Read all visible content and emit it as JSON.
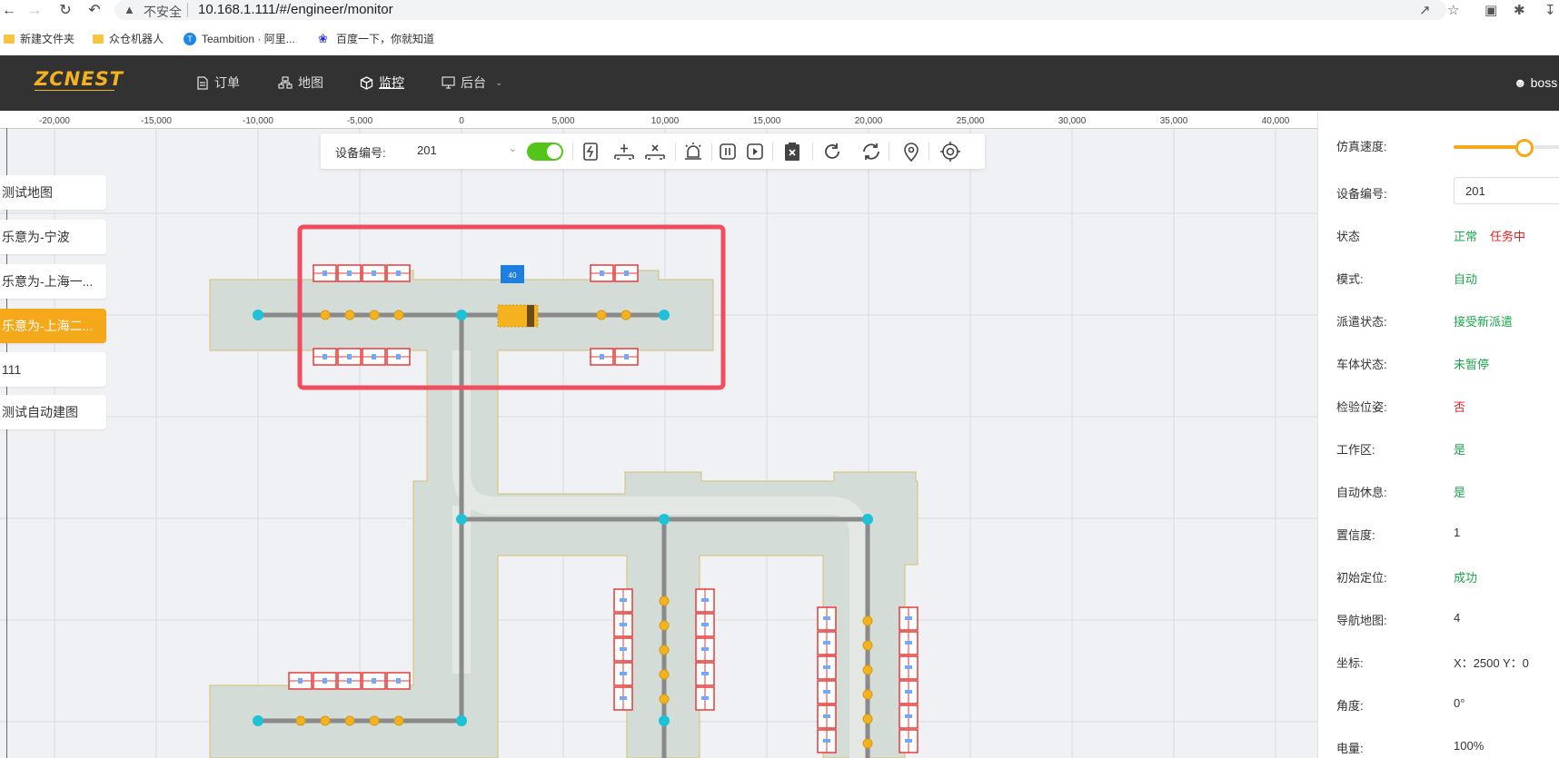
{
  "browser": {
    "url_warning": "不安全",
    "url": "10.168.1.111/#/engineer/monitor",
    "bookmarks": [
      "新建文件夹",
      "众仓机器人",
      "Teambition · 阿里...",
      "百度一下，你就知道"
    ]
  },
  "header": {
    "logo": "ZCNEST",
    "menu": [
      {
        "label": "订单",
        "icon": "document-icon"
      },
      {
        "label": "地图",
        "icon": "sitemap-icon"
      },
      {
        "label": "监控",
        "icon": "cube-icon",
        "active": true
      },
      {
        "label": "后台",
        "icon": "monitor-icon",
        "dropdown": true
      }
    ],
    "user": "boss"
  },
  "ruler": {
    "ticks": [
      "-20,000",
      "-15,000",
      "-10,000",
      "-5,000",
      "0",
      "5,000",
      "10,000",
      "15,000",
      "20,000",
      "25,000",
      "30,000",
      "35,000",
      "40,000"
    ]
  },
  "map_list": [
    {
      "label": "测试地图"
    },
    {
      "label": "乐意为-宁波"
    },
    {
      "label": "乐意为-上海一..."
    },
    {
      "label": "乐意为-上海二...",
      "active": true
    },
    {
      "label": "111"
    },
    {
      "label": "测试自动建图"
    }
  ],
  "toolbar": {
    "device_label": "设备编号:",
    "device_value": "201",
    "auto_switch_on": true,
    "icons": [
      "charge-icon",
      "pallet-add-icon",
      "pallet-remove-icon",
      "alarm-icon",
      "pause-icon",
      "play-icon",
      "clear-icon",
      "refresh-icon",
      "sync-icon",
      "location-pin-icon",
      "target-icon"
    ]
  },
  "map": {
    "vehicle_badge": "40",
    "colors": {
      "floor": "#d3dcd6",
      "highlight": "#f04d5f",
      "shelf": "#e83a3a",
      "node": "#1ec2d6",
      "station": "#f5b21f"
    }
  },
  "right_panel": {
    "speed_label": "仿真速度:",
    "speed_level": 0.6,
    "device_label": "设备编号:",
    "device_value": "201",
    "rows": [
      {
        "label": "状态",
        "value": "正常",
        "color": "green",
        "extra": "任务中",
        "extra_color": "red"
      },
      {
        "label": "模式:",
        "value": "自动",
        "color": "green"
      },
      {
        "label": "派遣状态:",
        "value": "接受新派遣",
        "color": "green"
      },
      {
        "label": "车体状态:",
        "value": "未暂停",
        "color": "green"
      },
      {
        "label": "检验位姿:",
        "value": "否",
        "color": "red"
      },
      {
        "label": "工作区:",
        "value": "是",
        "color": "green"
      },
      {
        "label": "自动休息:",
        "value": "是",
        "color": "green"
      },
      {
        "label": "置信度:",
        "value": "1",
        "color": "plain"
      },
      {
        "label": "初始定位:",
        "value": "成功",
        "color": "green"
      },
      {
        "label": "导航地图:",
        "value": "4",
        "color": "plain"
      },
      {
        "label": "坐标:",
        "value": "X：2500 Y：0",
        "color": "plain"
      },
      {
        "label": "角度:",
        "value": "0°",
        "color": "plain"
      },
      {
        "label": "电量:",
        "value": "100%",
        "color": "plain"
      }
    ]
  }
}
